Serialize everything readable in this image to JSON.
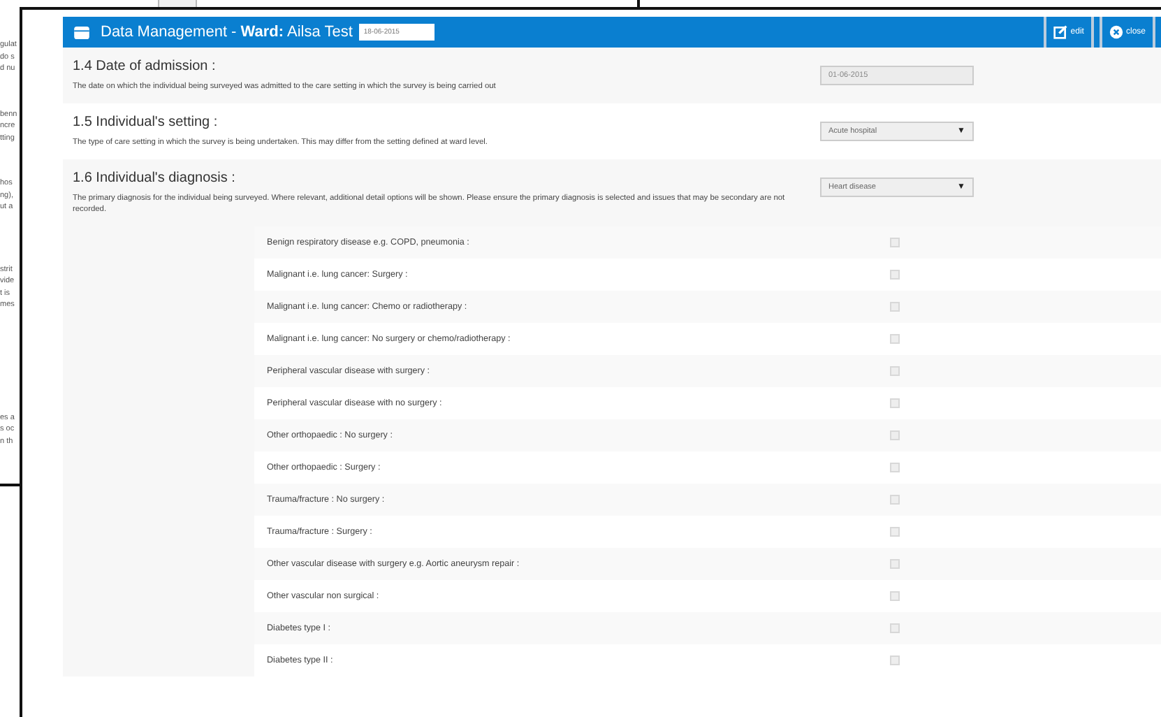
{
  "background_window": {
    "text_groups": [
      [
        "gulat",
        "do s",
        "d nu"
      ],
      [
        "benn",
        "ncre",
        "tting"
      ],
      [
        "hos",
        "ng),",
        "ut a"
      ],
      [
        "strit",
        "vide",
        "t is",
        "mes"
      ],
      [
        "es a",
        "s oc",
        "n th"
      ]
    ]
  },
  "dialog": {
    "title": "Data Management - ",
    "ward_label": "Ward:",
    "ward_name": "Ailsa Test",
    "date": "18-06-2015",
    "buttons": [
      {
        "kind": "edit",
        "label": "edit"
      },
      {
        "kind": "close",
        "label": "close"
      }
    ],
    "sections": [
      {
        "title": "1.4 Date of admission :",
        "description": "The date on which the individual being surveyed was admitted to the care setting in which the survey is being carried out",
        "field": {
          "kind": "text",
          "value": "01-06-2015"
        }
      },
      {
        "title": "1.5 Individual's setting :",
        "description": "The type of care setting in which the survey is being undertaken. This may differ from the setting defined at ward level.",
        "field": {
          "kind": "select",
          "value": "Acute hospital",
          "caret": "▼"
        }
      },
      {
        "title": "1.6 Individual's diagnosis :",
        "description": "The primary diagnosis for the individual being surveyed. Where relevant, additional detail options will be shown. Please ensure the primary diagnosis is selected and issues that may be secondary are not recorded.",
        "field": {
          "kind": "select",
          "value": "Heart disease",
          "caret": "▼"
        }
      }
    ],
    "options": [
      {
        "label": "Benign respiratory disease e.g. COPD, pneumonia :",
        "checked": false
      },
      {
        "label": "Malignant i.e. lung cancer: Surgery :",
        "checked": false
      },
      {
        "label": "Malignant i.e. lung cancer: Chemo or radiotherapy :",
        "checked": false
      },
      {
        "label": "Malignant i.e. lung cancer: No surgery or chemo/radiotherapy :",
        "checked": false
      },
      {
        "label": "Peripheral vascular disease with surgery :",
        "checked": false
      },
      {
        "label": "Peripheral vascular disease with no surgery :",
        "checked": false
      },
      {
        "label": "Other orthopaedic : No surgery :",
        "checked": false
      },
      {
        "label": "Other orthopaedic : Surgery :",
        "checked": false
      },
      {
        "label": "Trauma/fracture : No surgery :",
        "checked": false
      },
      {
        "label": "Trauma/fracture : Surgery :",
        "checked": false
      },
      {
        "label": "Other vascular disease with surgery e.g. Aortic aneurysm repair :",
        "checked": false
      },
      {
        "label": "Other vascular non surgical :",
        "checked": false
      },
      {
        "label": "Diabetes type I :",
        "checked": false
      },
      {
        "label": "Diabetes type II :",
        "checked": false
      }
    ]
  }
}
